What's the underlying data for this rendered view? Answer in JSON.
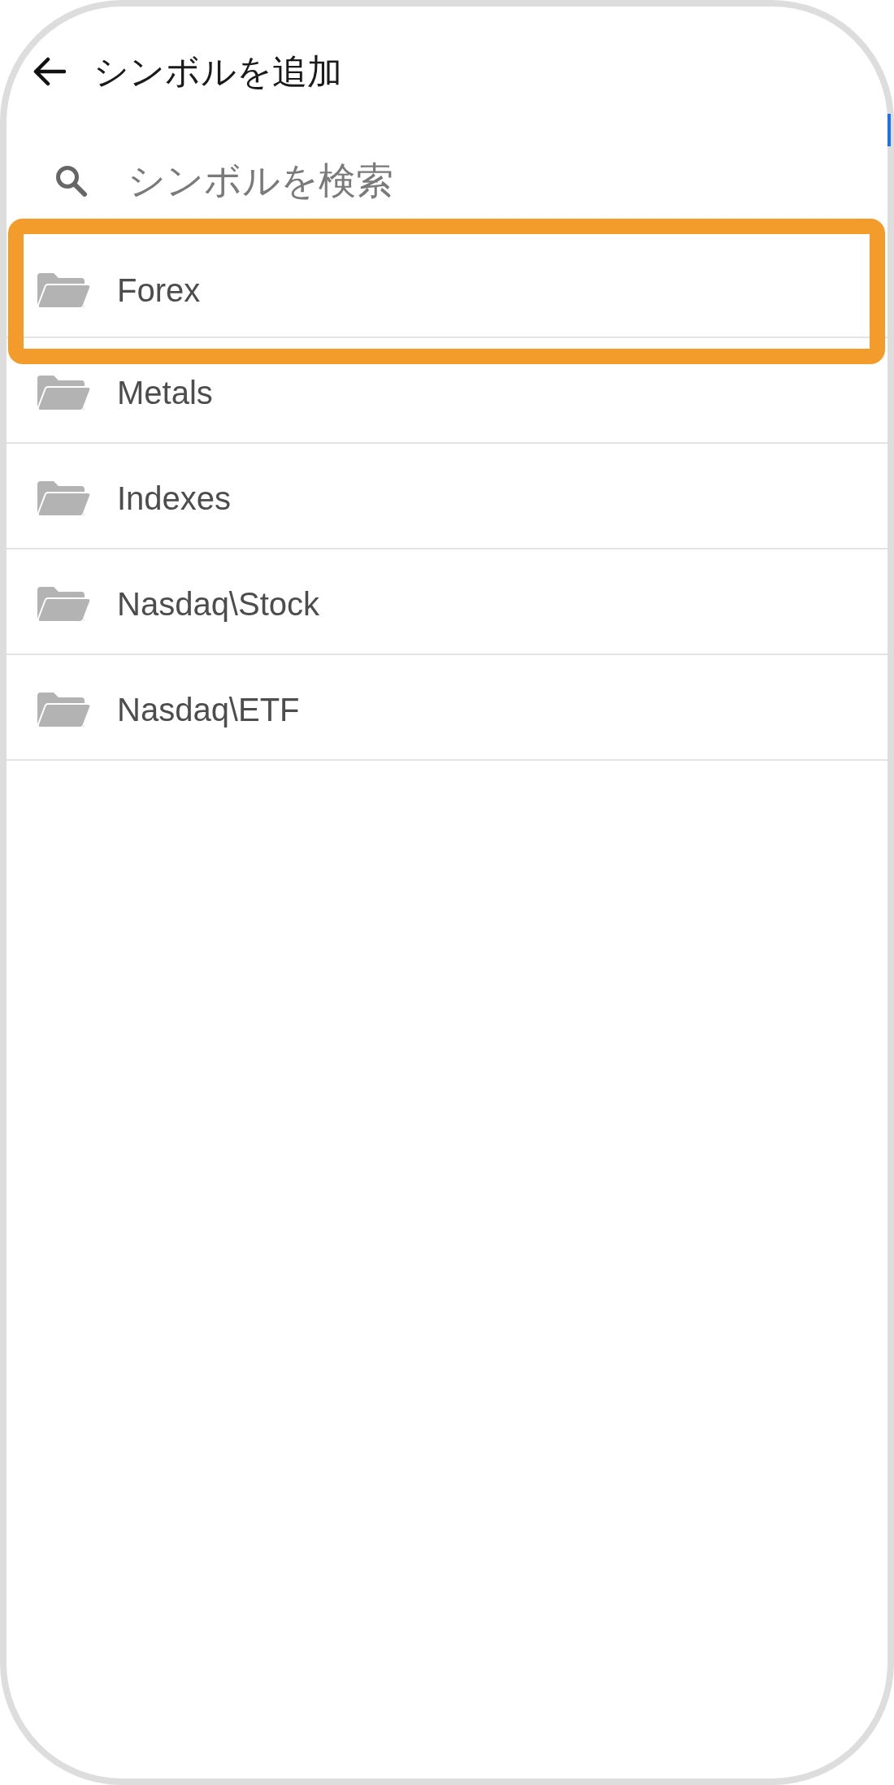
{
  "header": {
    "title": "シンボルを追加"
  },
  "search": {
    "placeholder": "シンボルを検索"
  },
  "folders": [
    {
      "name": "Forex",
      "highlighted": true
    },
    {
      "name": "Metals",
      "highlighted": false
    },
    {
      "name": "Indexes",
      "highlighted": false
    },
    {
      "name": "Nasdaq\\Stock",
      "highlighted": false
    },
    {
      "name": "Nasdaq\\ETF",
      "highlighted": false
    }
  ]
}
